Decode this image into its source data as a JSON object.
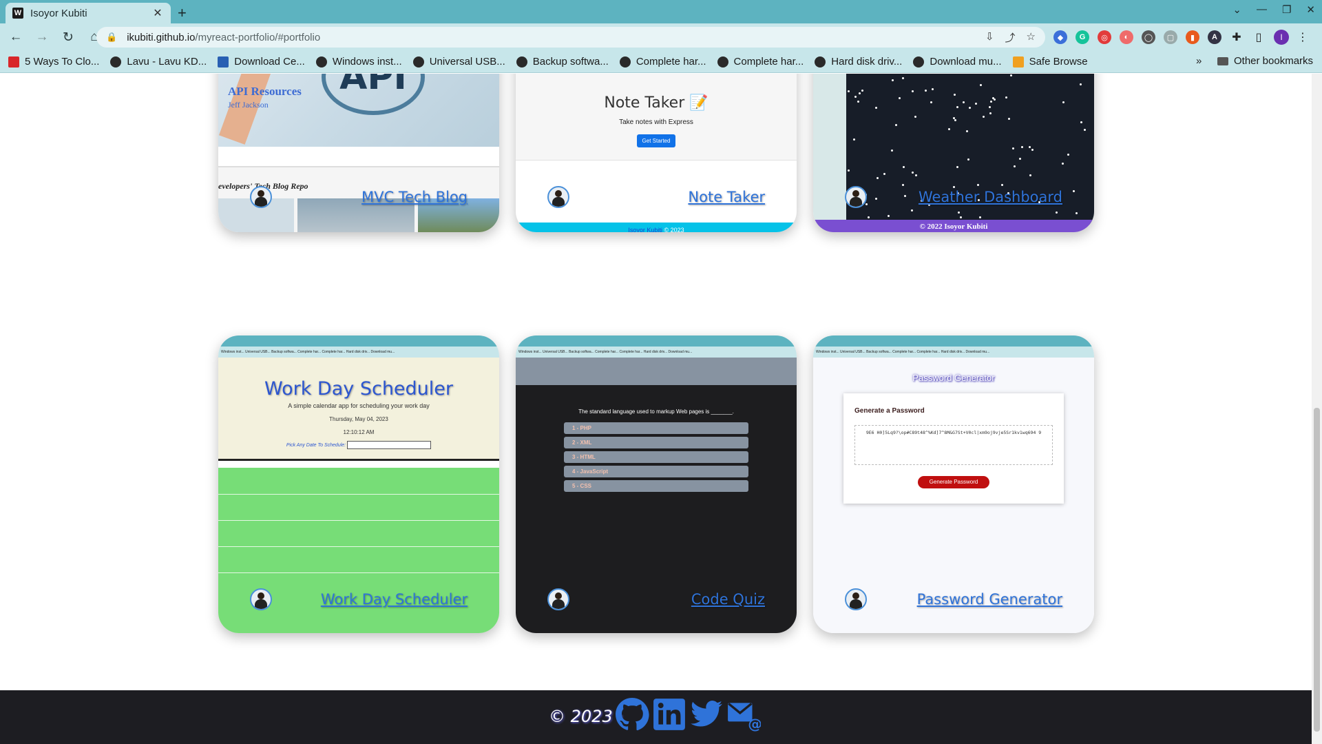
{
  "browser": {
    "tab_title": "Isoyor Kubiti",
    "tab_favicon": "W",
    "new_tab": "+",
    "url_host": "ikubiti.github.io",
    "url_path": "/myreact-portfolio/#portfolio",
    "profile_initial": "I"
  },
  "bookmarks": [
    {
      "label": "5 Ways To Clo...",
      "icon": "red"
    },
    {
      "label": "Lavu - Lavu KD...",
      "icon": "dark"
    },
    {
      "label": "Download Ce...",
      "icon": "blue"
    },
    {
      "label": "Windows inst...",
      "icon": "dark"
    },
    {
      "label": "Universal USB...",
      "icon": "dark"
    },
    {
      "label": "Backup softwa...",
      "icon": "dark"
    },
    {
      "label": "Complete har...",
      "icon": "dark"
    },
    {
      "label": "Complete har...",
      "icon": "dark"
    },
    {
      "label": "Hard disk driv...",
      "icon": "dark"
    },
    {
      "label": "Download mu...",
      "icon": "dark"
    },
    {
      "label": "Safe Browse",
      "icon": "orange"
    }
  ],
  "other_bookmarks": "Other bookmarks",
  "more_bookmarks": "»",
  "projects_top": [
    {
      "link": "MVC Tech Blog",
      "preview": {
        "heading": "API",
        "caption": "API Resources",
        "caption2": "Jeff Jackson",
        "blog_title": "evelopers' Tech Blog Repo"
      }
    },
    {
      "link": "Note Taker",
      "preview": {
        "title": "Note Taker 📝",
        "subtitle": "Take notes with Express",
        "button": "Get Started",
        "footer_name": "Isoyor Kubiti",
        "footer_year": " © 2023"
      }
    },
    {
      "link": "Weather Dashboard",
      "preview": {
        "footer": "© 2022 Isoyor Kubiti"
      }
    }
  ],
  "projects_bottom": [
    {
      "link": "Work Day Scheduler",
      "preview": {
        "title": "Work Day Scheduler",
        "subtitle": "A simple calendar app for scheduling your work day",
        "date": "Thursday, May 04, 2023",
        "time": "12:10:12 AM",
        "pick_label": "Pick Any Date To Schedule"
      }
    },
    {
      "link": "Code Quiz",
      "preview": {
        "question": "The standard language used to markup Web pages is _______.",
        "options": [
          "1 - PHP",
          "2 - XML",
          "3 - HTML",
          "4 - JavaScript",
          "5 - CSS"
        ]
      }
    },
    {
      "link": "Password Generator",
      "preview": {
        "title": "Password Generator",
        "box_title": "Generate a Password",
        "password": "9E6 H0]5Lq9?\\op#C89t48^%Kd]7^8M&G7St+V0cl|xm9oj9vje5Sr1kv1wq694 9",
        "button": "Generate Password"
      }
    }
  ],
  "mini_bookmarks": "Windows inst...   Universal USB...   Backup softwa...   Complete har...   Complete har...   Hard disk driv...   Download mu...",
  "footer": {
    "copyright": "© 2023 ·",
    "icons": [
      "github-icon",
      "linkedin-icon",
      "twitter-icon",
      "email-icon"
    ]
  },
  "colors": {
    "tab_strip": "#5db3c0",
    "toolbar": "#c7e6ea",
    "link": "#2f73d9",
    "footer_bg": "#1d1d22"
  }
}
